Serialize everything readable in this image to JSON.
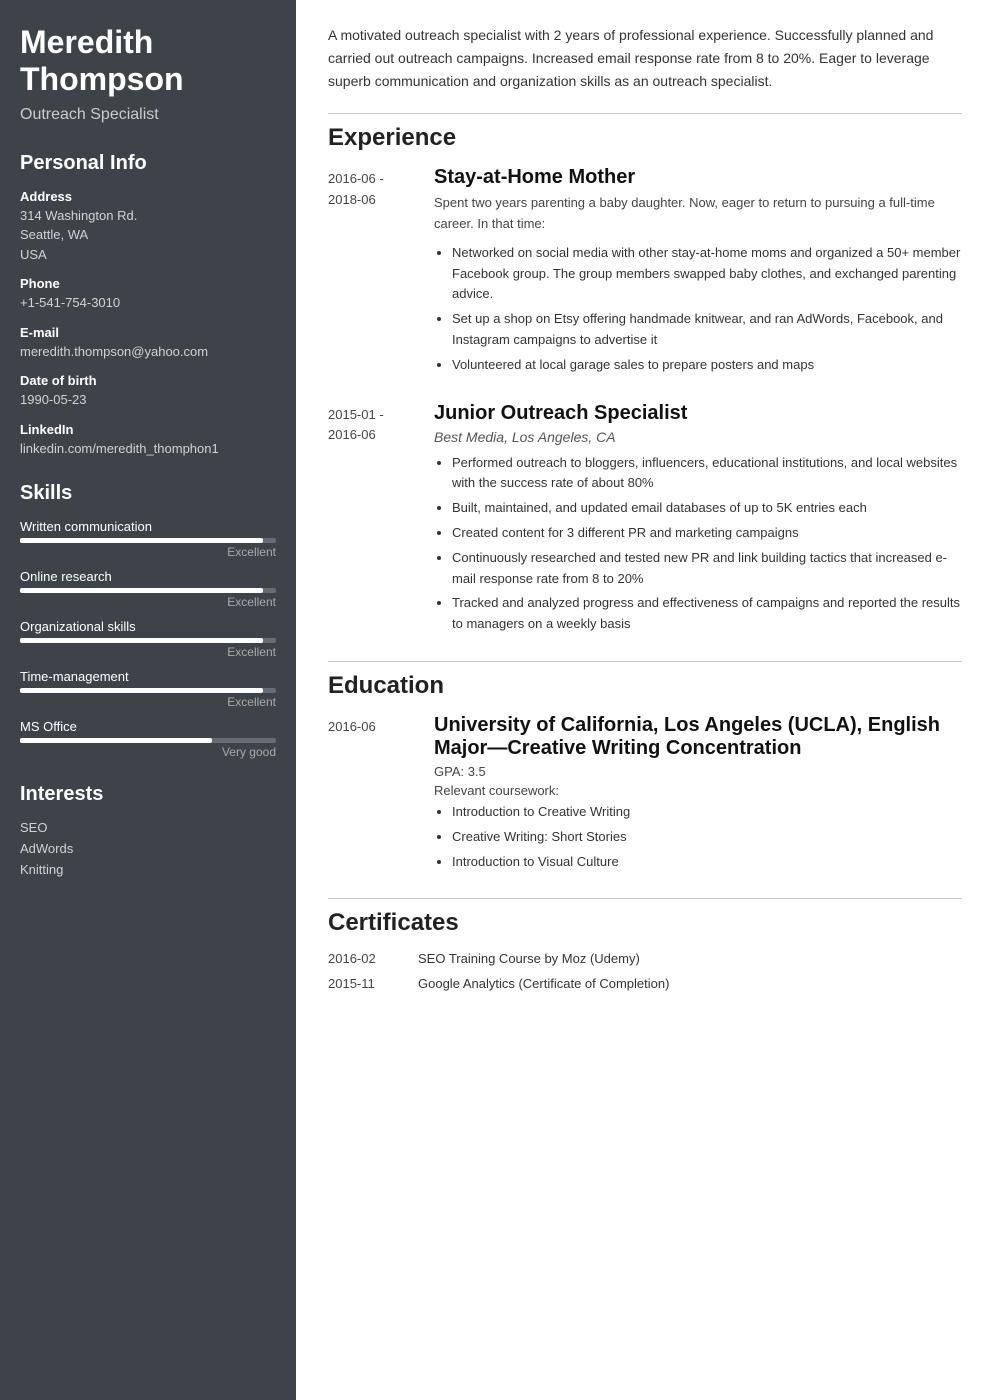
{
  "sidebar": {
    "name": "Meredith Thompson",
    "title": "Outreach Specialist",
    "personal_info_section": "Personal Info",
    "address_label": "Address",
    "address_line1": "314 Washington Rd.",
    "address_line2": "Seattle, WA",
    "address_line3": "USA",
    "phone_label": "Phone",
    "phone": "+1-541-754-3010",
    "email_label": "E-mail",
    "email": "meredith.thompson@yahoo.com",
    "dob_label": "Date of birth",
    "dob": "1990-05-23",
    "linkedin_label": "LinkedIn",
    "linkedin": "linkedin.com/meredith_thomphon1",
    "skills_section": "Skills",
    "skills": [
      {
        "name": "Written communication",
        "level": "Excellent",
        "percent": 95
      },
      {
        "name": "Online research",
        "level": "Excellent",
        "percent": 95
      },
      {
        "name": "Organizational skills",
        "level": "Excellent",
        "percent": 95
      },
      {
        "name": "Time-management",
        "level": "Excellent",
        "percent": 95
      },
      {
        "name": "MS Office",
        "level": "Very good",
        "percent": 75
      }
    ],
    "interests_section": "Interests",
    "interests": [
      "SEO",
      "AdWords",
      "Knitting"
    ]
  },
  "main": {
    "summary": "A motivated outreach specialist with 2 years of professional experience. Successfully planned and carried out outreach campaigns. Increased email response rate from 8 to 20%. Eager to leverage superb communication and organization skills as an outreach specialist.",
    "experience_section": "Experience",
    "experiences": [
      {
        "date_range": "2016-06 -\n2018-06",
        "title": "Stay-at-Home Mother",
        "subtitle": "",
        "desc": "Spent two years parenting a baby daughter. Now, eager to return to pursuing a full-time career. In that time:",
        "bullets": [
          "Networked on social media with other stay-at-home moms and organized a 50+ member Facebook group. The group members swapped baby clothes, and exchanged parenting advice.",
          "Set up a shop on Etsy offering handmade knitwear, and ran AdWords, Facebook, and Instagram campaigns to advertise it",
          "Volunteered at local garage sales to prepare posters and maps"
        ]
      },
      {
        "date_range": "2015-01 -\n2016-06",
        "title": "Junior Outreach Specialist",
        "subtitle": "Best Media, Los Angeles, CA",
        "desc": "",
        "bullets": [
          "Performed outreach to bloggers, influencers, educational institutions, and local websites with the success rate of about 80%",
          "Built, maintained, and updated email databases of up to 5K entries each",
          "Created content for 3 different PR and marketing campaigns",
          "Continuously researched and tested new PR and link building tactics that increased e-mail response rate from 8 to 20%",
          "Tracked and analyzed progress and effectiveness of campaigns and reported the results to managers on a weekly basis"
        ]
      }
    ],
    "education_section": "Education",
    "educations": [
      {
        "date": "2016-06",
        "title": "University of California, Los Angeles (UCLA), English Major—Creative Writing Concentration",
        "gpa_label": "GPA: 3.5",
        "coursework_label": "Relevant coursework:",
        "bullets": [
          "Introduction to Creative Writing",
          "Creative Writing: Short Stories",
          "Introduction to Visual Culture"
        ]
      }
    ],
    "certificates_section": "Certificates",
    "certificates": [
      {
        "date": "2016-02",
        "name": "SEO Training Course by Moz (Udemy)"
      },
      {
        "date": "2015-11",
        "name": "Google Analytics (Certificate of Completion)"
      }
    ]
  }
}
